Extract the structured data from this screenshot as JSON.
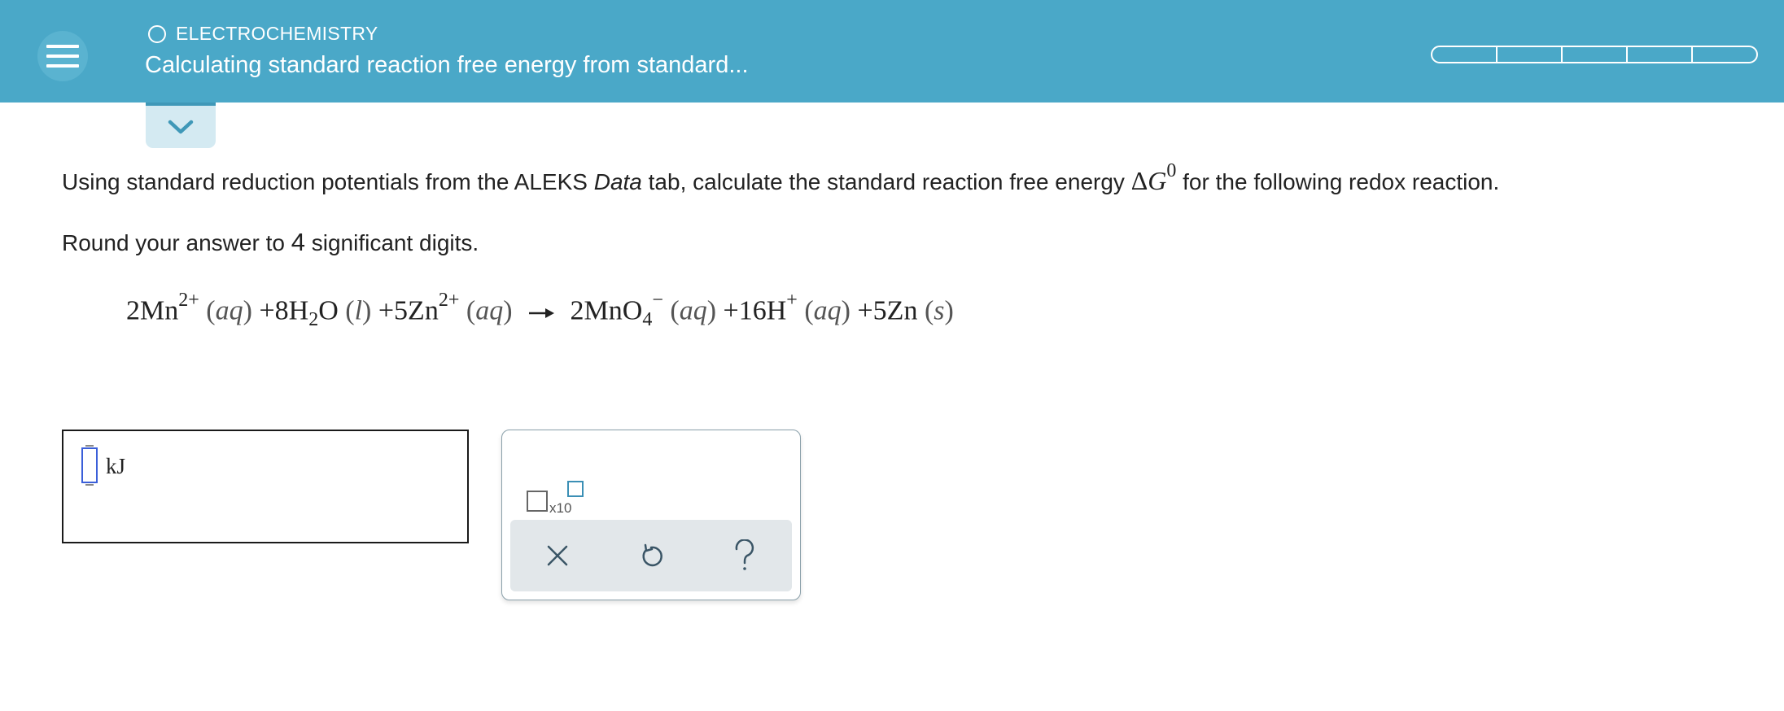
{
  "header": {
    "topic": "ELECTROCHEMISTRY",
    "title": "Calculating standard reaction free energy from standard...",
    "progress_segments": 5,
    "background_color": "#4aa8c8"
  },
  "question": {
    "instruction_prefix": "Using standard reduction potentials from the ALEKS ",
    "instruction_italic": "Data",
    "instruction_mid": " tab, calculate the standard reaction free energy ",
    "symbol_delta": "Δ",
    "symbol_G": "G",
    "symbol_sup": "0",
    "instruction_suffix": " for the following redox reaction.",
    "round_prefix": "Round your answer to ",
    "round_digits": "4",
    "round_suffix": " significant digits."
  },
  "equation": {
    "t1_coef": "2Mn",
    "t1_charge": "2+",
    "t1_phase": "aq",
    "plus1": "+",
    "t2_coef": "8H",
    "t2_sub": "2",
    "t2_rest": "O",
    "t2_phase": "l",
    "plus2": "+",
    "t3_coef": "5Zn",
    "t3_charge": "2+",
    "t3_phase": "aq",
    "p1_coef": "2MnO",
    "p1_sub": "4",
    "p1_charge": "−",
    "p1_phase": "aq",
    "plus3": "+",
    "p2_coef": "16H",
    "p2_charge": "+",
    "p2_phase": "aq",
    "plus4": "+",
    "p3_coef": "5Zn",
    "p3_phase": "s"
  },
  "answer": {
    "value": "",
    "unit": "kJ"
  },
  "palette": {
    "sci_label": "x10",
    "clear_icon": "x-icon",
    "undo_icon": "undo-icon",
    "help_icon": "help-icon"
  }
}
